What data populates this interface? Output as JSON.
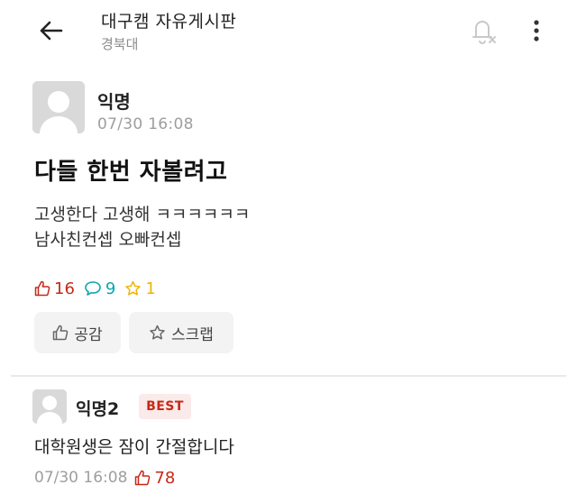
{
  "header": {
    "board_name": "대구캠 자유게시판",
    "school": "경북대",
    "icons": {
      "back": "arrow-left-icon",
      "notify": "bell-off-icon",
      "more": "more-vertical-icon"
    }
  },
  "post": {
    "author": "익명",
    "time": "07/30 16:08",
    "title": "다들 한번 자볼려고",
    "body_lines": [
      "고생한다 고생해 ㅋㅋㅋㅋㅋㅋ",
      "남사친컨셉 오빠컨셉"
    ],
    "stats": {
      "likes": "16",
      "comments": "9",
      "scraps": "1"
    },
    "actions": {
      "empathy_label": "공감",
      "scrap_label": "스크랩"
    }
  },
  "comments": [
    {
      "author": "익명2",
      "badge": "BEST",
      "text": "대학원생은 잠이 간절합니다",
      "time": "07/30 16:08",
      "likes": "78"
    }
  ],
  "colors": {
    "like": "#c62917",
    "comment": "#0ca5af",
    "scrap": "#f0b400",
    "muted": "#9e9e9e",
    "button_bg": "#f3f3f3"
  }
}
